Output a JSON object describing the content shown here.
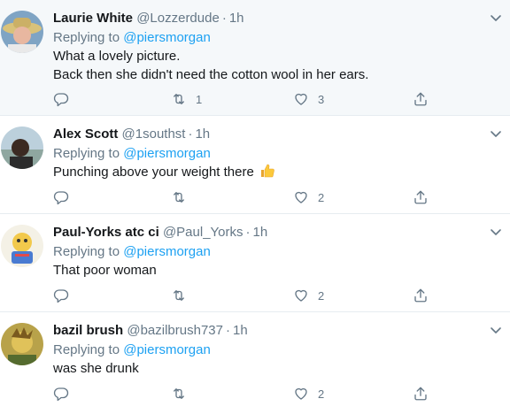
{
  "colors": {
    "accent": "#1da1f2",
    "muted": "#657786",
    "text": "#14171a",
    "highlight_bg": "#f5f8fa"
  },
  "icons": {
    "reply": "reply-icon",
    "retweet": "retweet-icon",
    "like": "heart-icon",
    "share": "share-icon",
    "menu": "chevron-down-icon"
  },
  "replying_to_label": "Replying to",
  "separator": "·",
  "tweets": [
    {
      "name": "Laurie White",
      "handle": "@Lozzerdude",
      "time": "1h",
      "replying_to": "@piersmorgan",
      "lines": [
        "What a lovely picture.",
        "Back then she didn't need the cotton wool in her ears."
      ],
      "retweets": "1",
      "likes": "3"
    },
    {
      "name": "Alex Scott",
      "handle": "@1southst",
      "time": "1h",
      "replying_to": "@piersmorgan",
      "lines": [
        "Punching above your weight there"
      ],
      "emoji": "thumbs-up",
      "retweets": "",
      "likes": "2"
    },
    {
      "name": "Paul-Yorks atc ci",
      "handle": "@Paul_Yorks",
      "time": "1h",
      "replying_to": "@piersmorgan",
      "lines": [
        "That poor woman"
      ],
      "retweets": "",
      "likes": "2"
    },
    {
      "name": "bazil brush",
      "handle": "@bazilbrush737",
      "time": "1h",
      "replying_to": "@piersmorgan",
      "lines": [
        "was she drunk"
      ],
      "retweets": "",
      "likes": "2"
    }
  ]
}
